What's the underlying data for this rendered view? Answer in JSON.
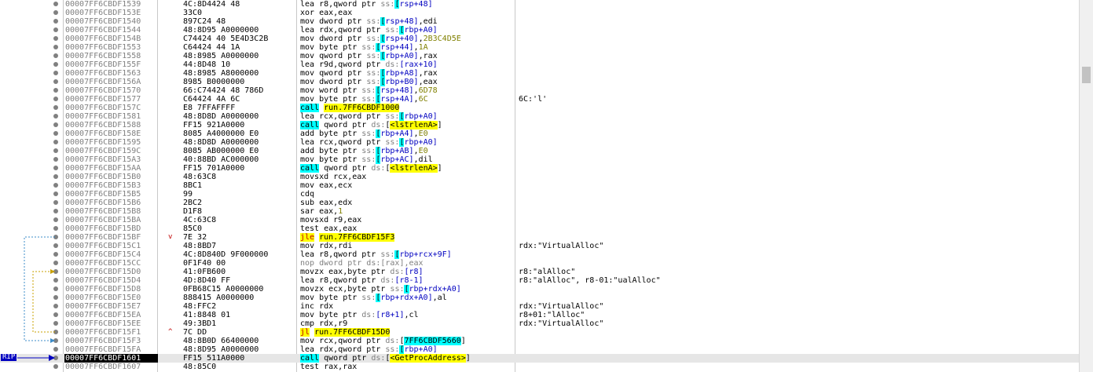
{
  "rip_label": "RIP",
  "rows": [
    {
      "addr": "00007FF6CBDF1539",
      "bytes": "4C:8D4424 48",
      "ins": "lea",
      "ops": [
        [
          "r8,qword ptr ",
          ""
        ],
        [
          "ss:",
          "sseg"
        ],
        [
          "[",
          "reg-hl"
        ],
        [
          "rsp+48]",
          "mem"
        ]
      ],
      "cmt": ""
    },
    {
      "addr": "00007FF6CBDF153E",
      "bytes": "33C0",
      "ins": "xor",
      "ops": [
        [
          "eax,eax",
          ""
        ]
      ],
      "cmt": ""
    },
    {
      "addr": "00007FF6CBDF1540",
      "bytes": "897C24 48",
      "ins": "mov",
      "ops": [
        [
          "dword ptr ",
          ""
        ],
        [
          "ss:",
          "sseg"
        ],
        [
          "[",
          "reg-hl"
        ],
        [
          "rsp+48]",
          "mem"
        ],
        [
          ",edi",
          ""
        ]
      ],
      "cmt": ""
    },
    {
      "addr": "00007FF6CBDF1544",
      "bytes": "48:8D95 A0000000",
      "ins": "lea",
      "ops": [
        [
          "rdx,qword ptr ",
          ""
        ],
        [
          "ss:",
          "sseg"
        ],
        [
          "[",
          "reg-hl"
        ],
        [
          "rbp+A0]",
          "mem"
        ]
      ],
      "cmt": ""
    },
    {
      "addr": "00007FF6CBDF154B",
      "bytes": "C74424 40 5E4D3C2B",
      "ins": "mov",
      "ops": [
        [
          "dword ptr ",
          ""
        ],
        [
          "ss:",
          "sseg"
        ],
        [
          "[",
          "reg-hl"
        ],
        [
          "rsp+40]",
          "mem"
        ],
        [
          ",",
          ""
        ],
        [
          "2B3C4D5E",
          "imm"
        ]
      ],
      "cmt": ""
    },
    {
      "addr": "00007FF6CBDF1553",
      "bytes": "C64424 44 1A",
      "ins": "mov",
      "ops": [
        [
          "byte ptr ",
          ""
        ],
        [
          "ss:",
          "sseg"
        ],
        [
          "[",
          "reg-hl"
        ],
        [
          "rsp+44]",
          "mem"
        ],
        [
          ",",
          ""
        ],
        [
          "1A",
          "imm"
        ]
      ],
      "cmt": ""
    },
    {
      "addr": "00007FF6CBDF1558",
      "bytes": "48:8985 A0000000",
      "ins": "mov",
      "ops": [
        [
          "qword ptr ",
          ""
        ],
        [
          "ss:",
          "sseg"
        ],
        [
          "[",
          "reg-hl"
        ],
        [
          "rbp+A0]",
          "mem"
        ],
        [
          ",rax",
          ""
        ]
      ],
      "cmt": ""
    },
    {
      "addr": "00007FF6CBDF155F",
      "bytes": "44:8D48 10",
      "ins": "lea",
      "ops": [
        [
          "r9d,qword ptr ",
          ""
        ],
        [
          "ds:",
          "sseg"
        ],
        [
          "[rax+10]",
          "mem"
        ]
      ],
      "cmt": ""
    },
    {
      "addr": "00007FF6CBDF1563",
      "bytes": "48:8985 A8000000",
      "ins": "mov",
      "ops": [
        [
          "qword ptr ",
          ""
        ],
        [
          "ss:",
          "sseg"
        ],
        [
          "[",
          "reg-hl"
        ],
        [
          "rbp+A8]",
          "mem"
        ],
        [
          ",rax",
          ""
        ]
      ],
      "cmt": ""
    },
    {
      "addr": "00007FF6CBDF156A",
      "bytes": "8985 B0000000",
      "ins": "mov",
      "ops": [
        [
          "dword ptr ",
          ""
        ],
        [
          "ss:",
          "sseg"
        ],
        [
          "[",
          "reg-hl"
        ],
        [
          "rbp+B0]",
          "mem"
        ],
        [
          ",eax",
          ""
        ]
      ],
      "cmt": ""
    },
    {
      "addr": "00007FF6CBDF1570",
      "bytes": "66:C74424 48 786D",
      "ins": "mov",
      "ops": [
        [
          "word ptr ",
          ""
        ],
        [
          "ss:",
          "sseg"
        ],
        [
          "[",
          "reg-hl"
        ],
        [
          "rsp+48]",
          "mem"
        ],
        [
          ",",
          ""
        ],
        [
          "6D78",
          "imm"
        ]
      ],
      "cmt": ""
    },
    {
      "addr": "00007FF6CBDF1577",
      "bytes": "C64424 4A 6C",
      "ins": "mov",
      "ops": [
        [
          "byte ptr ",
          ""
        ],
        [
          "ss:",
          "sseg"
        ],
        [
          "[",
          "reg-hl"
        ],
        [
          "rsp+4A]",
          "mem"
        ],
        [
          ",",
          ""
        ],
        [
          "6C",
          "imm"
        ]
      ],
      "cmt": "6C:'l'"
    },
    {
      "addr": "00007FF6CBDF157C",
      "bytes": "E8 7FFAFFFF",
      "ins": "call",
      "ops": [
        [
          "run.7FF6CBDF1000",
          "t-tgt"
        ]
      ],
      "cmt": ""
    },
    {
      "addr": "00007FF6CBDF1581",
      "bytes": "48:8D8D A0000000",
      "ins": "lea",
      "ops": [
        [
          "rcx,qword ptr ",
          ""
        ],
        [
          "ss:",
          "sseg"
        ],
        [
          "[",
          "reg-hl"
        ],
        [
          "rbp+A0]",
          "mem"
        ]
      ],
      "cmt": ""
    },
    {
      "addr": "00007FF6CBDF1588",
      "bytes": "FF15 921A0000",
      "ins": "call",
      "ops": [
        [
          "qword ptr ",
          ""
        ],
        [
          "ds:",
          "sseg"
        ],
        [
          "[",
          ""
        ],
        [
          "<lstrlenA>",
          "t-sym"
        ],
        [
          "]",
          ""
        ]
      ],
      "cmt": ""
    },
    {
      "addr": "00007FF6CBDF158E",
      "bytes": "8085 A4000000 E0",
      "ins": "add",
      "ops": [
        [
          "byte ptr ",
          ""
        ],
        [
          "ss:",
          "sseg"
        ],
        [
          "[",
          "reg-hl"
        ],
        [
          "rbp+A4]",
          "mem"
        ],
        [
          ",",
          ""
        ],
        [
          "E0",
          "imm"
        ]
      ],
      "cmt": ""
    },
    {
      "addr": "00007FF6CBDF1595",
      "bytes": "48:8D8D A0000000",
      "ins": "lea",
      "ops": [
        [
          "rcx,qword ptr ",
          ""
        ],
        [
          "ss:",
          "sseg"
        ],
        [
          "[",
          "reg-hl"
        ],
        [
          "rbp+A0]",
          "mem"
        ]
      ],
      "cmt": ""
    },
    {
      "addr": "00007FF6CBDF159C",
      "bytes": "8085 AB000000 E0",
      "ins": "add",
      "ops": [
        [
          "byte ptr ",
          ""
        ],
        [
          "ss:",
          "sseg"
        ],
        [
          "[",
          "reg-hl"
        ],
        [
          "rbp+AB]",
          "mem"
        ],
        [
          ",",
          ""
        ],
        [
          "E0",
          "imm"
        ]
      ],
      "cmt": ""
    },
    {
      "addr": "00007FF6CBDF15A3",
      "bytes": "40:88BD AC000000",
      "ins": "mov",
      "ops": [
        [
          "byte ptr ",
          ""
        ],
        [
          "ss:",
          "sseg"
        ],
        [
          "[",
          "reg-hl"
        ],
        [
          "rbp+AC]",
          "mem"
        ],
        [
          ",dil",
          ""
        ]
      ],
      "cmt": ""
    },
    {
      "addr": "00007FF6CBDF15AA",
      "bytes": "FF15 701A0000",
      "ins": "call",
      "ops": [
        [
          "qword ptr ",
          ""
        ],
        [
          "ds:",
          "sseg"
        ],
        [
          "[",
          ""
        ],
        [
          "<lstrlenA>",
          "t-sym"
        ],
        [
          "]",
          ""
        ]
      ],
      "cmt": ""
    },
    {
      "addr": "00007FF6CBDF15B0",
      "bytes": "48:63C8",
      "ins": "movsxd",
      "ops": [
        [
          "rcx,eax",
          ""
        ]
      ],
      "cmt": ""
    },
    {
      "addr": "00007FF6CBDF15B3",
      "bytes": "8BC1",
      "ins": "mov",
      "ops": [
        [
          "eax,ecx",
          ""
        ]
      ],
      "cmt": ""
    },
    {
      "addr": "00007FF6CBDF15B5",
      "bytes": "99",
      "ins": "cdq",
      "ops": [],
      "cmt": ""
    },
    {
      "addr": "00007FF6CBDF15B6",
      "bytes": "2BC2",
      "ins": "sub",
      "ops": [
        [
          "eax,edx",
          ""
        ]
      ],
      "cmt": ""
    },
    {
      "addr": "00007FF6CBDF15B8",
      "bytes": "D1F8",
      "ins": "sar",
      "ops": [
        [
          "eax,",
          ""
        ],
        [
          "1",
          "imm"
        ]
      ],
      "cmt": ""
    },
    {
      "addr": "00007FF6CBDF15BA",
      "bytes": "4C:63C8",
      "ins": "movsxd",
      "ops": [
        [
          "r9,eax",
          ""
        ]
      ],
      "cmt": ""
    },
    {
      "addr": "00007FF6CBDF15BD",
      "bytes": "85C0",
      "ins": "test",
      "ops": [
        [
          "eax,eax",
          ""
        ]
      ],
      "cmt": ""
    },
    {
      "addr": "00007FF6CBDF15BF",
      "bytes": "7E 32",
      "jmp": "v",
      "ins": "jle",
      "ops": [
        [
          "run.7FF6CBDF15F3",
          "t-tgt"
        ]
      ],
      "cmt": ""
    },
    {
      "addr": "00007FF6CBDF15C1",
      "bytes": "48:8BD7",
      "ins": "mov",
      "ops": [
        [
          "rdx,rdi",
          ""
        ]
      ],
      "cmt": "rdx:\"VirtualAlloc\""
    },
    {
      "addr": "00007FF6CBDF15C4",
      "bytes": "4C:8D840D 9F000000",
      "ins": "lea",
      "ops": [
        [
          "r8,qword ptr ",
          ""
        ],
        [
          "ss:",
          "sseg"
        ],
        [
          "[",
          "reg-hl"
        ],
        [
          "rbp+rcx+9F]",
          "mem"
        ]
      ],
      "cmt": ""
    },
    {
      "addr": "00007FF6CBDF15CC",
      "bytes": "0F1F40 00",
      "ins": "nop",
      "ops": [
        [
          "dword ptr ds:[rax],eax",
          "kw-nop"
        ]
      ],
      "cmt": ""
    },
    {
      "addr": "00007FF6CBDF15D0",
      "bytes": "41:0FB600",
      "ins": "movzx",
      "ops": [
        [
          "eax,byte ptr ",
          ""
        ],
        [
          "ds:",
          "sseg"
        ],
        [
          "[r8]",
          "mem"
        ]
      ],
      "cmt": "r8:\"alAlloc\""
    },
    {
      "addr": "00007FF6CBDF15D4",
      "bytes": "4D:8D40 FF",
      "ins": "lea",
      "ops": [
        [
          "r8,qword ptr ",
          ""
        ],
        [
          "ds:",
          "sseg"
        ],
        [
          "[r8-1]",
          "mem"
        ]
      ],
      "cmt": "r8:\"alAlloc\", r8-01:\"ualAlloc\""
    },
    {
      "addr": "00007FF6CBDF15D8",
      "bytes": "0FB68C15 A0000000",
      "ins": "movzx",
      "ops": [
        [
          "ecx,byte ptr ",
          ""
        ],
        [
          "ss:",
          "sseg"
        ],
        [
          "[",
          "reg-hl"
        ],
        [
          "rbp+rdx+A0]",
          "mem"
        ]
      ],
      "cmt": ""
    },
    {
      "addr": "00007FF6CBDF15E0",
      "bytes": "888415 A0000000",
      "ins": "mov",
      "ops": [
        [
          "byte ptr ",
          ""
        ],
        [
          "ss:",
          "sseg"
        ],
        [
          "[",
          "reg-hl"
        ],
        [
          "rbp+rdx+A0]",
          "mem"
        ],
        [
          ",al",
          ""
        ]
      ],
      "cmt": ""
    },
    {
      "addr": "00007FF6CBDF15E7",
      "bytes": "48:FFC2",
      "ins": "inc",
      "ops": [
        [
          "rdx",
          ""
        ]
      ],
      "cmt": "rdx:\"VirtualAlloc\""
    },
    {
      "addr": "00007FF6CBDF15EA",
      "bytes": "41:8848 01",
      "ins": "mov",
      "ops": [
        [
          "byte ptr ",
          ""
        ],
        [
          "ds:",
          "sseg"
        ],
        [
          "[r8+1]",
          "mem"
        ],
        [
          ",cl",
          ""
        ]
      ],
      "cmt": "r8+01:\"lAlloc\""
    },
    {
      "addr": "00007FF6CBDF15EE",
      "bytes": "49:3BD1",
      "ins": "cmp",
      "ops": [
        [
          "rdx,r9",
          ""
        ]
      ],
      "cmt": "rdx:\"VirtualAlloc\""
    },
    {
      "addr": "00007FF6CBDF15F1",
      "bytes": "7C DD",
      "jmp": "^",
      "ins": "jl",
      "ops": [
        [
          "run.7FF6CBDF15D0",
          "t-tgt"
        ]
      ],
      "cmt": ""
    },
    {
      "addr": "00007FF6CBDF15F3",
      "bytes": "48:8B0D 66400000",
      "ins": "mov",
      "ops": [
        [
          "rcx,qword ptr ",
          ""
        ],
        [
          "ds:",
          "sseg"
        ],
        [
          "[",
          ""
        ],
        [
          "7FF6CBDF5660",
          "reg-hl"
        ],
        [
          "]",
          ""
        ]
      ],
      "cmt": ""
    },
    {
      "addr": "00007FF6CBDF15FA",
      "bytes": "48:8D95 A0000000",
      "ins": "lea",
      "ops": [
        [
          "rdx,qword ptr ",
          ""
        ],
        [
          "ss:",
          "sseg"
        ],
        [
          "[",
          "reg-hl"
        ],
        [
          "rbp+A0]",
          "mem"
        ]
      ],
      "cmt": ""
    },
    {
      "addr": "00007FF6CBDF1601",
      "bytes": "FF15 511A0000",
      "ins": "call",
      "ops": [
        [
          "qword ptr ",
          ""
        ],
        [
          "ds:",
          "sseg"
        ],
        [
          "[",
          ""
        ],
        [
          "<GetProcAddress>",
          "t-sym"
        ],
        [
          "]",
          ""
        ]
      ],
      "cmt": "",
      "current": true
    },
    {
      "addr": "00007FF6CBDF1607",
      "bytes": "48:85C0",
      "ins": "test",
      "ops": [
        [
          "rax,rax",
          ""
        ]
      ],
      "cmt": ""
    }
  ]
}
